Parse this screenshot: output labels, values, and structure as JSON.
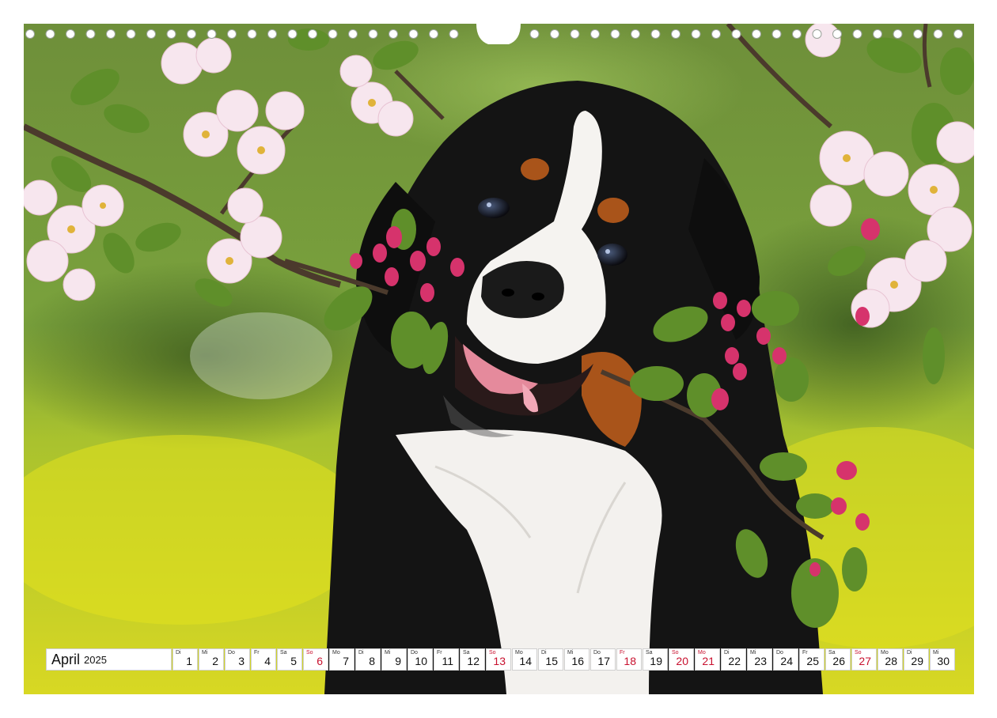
{
  "calendar": {
    "month": "April",
    "year": "2025",
    "days": [
      {
        "wd": "Di",
        "d": "1",
        "red": false
      },
      {
        "wd": "Mi",
        "d": "2",
        "red": false
      },
      {
        "wd": "Do",
        "d": "3",
        "red": false
      },
      {
        "wd": "Fr",
        "d": "4",
        "red": false
      },
      {
        "wd": "Sa",
        "d": "5",
        "red": false
      },
      {
        "wd": "So",
        "d": "6",
        "red": true
      },
      {
        "wd": "Mo",
        "d": "7",
        "red": false
      },
      {
        "wd": "Di",
        "d": "8",
        "red": false
      },
      {
        "wd": "Mi",
        "d": "9",
        "red": false
      },
      {
        "wd": "Do",
        "d": "10",
        "red": false
      },
      {
        "wd": "Fr",
        "d": "11",
        "red": false
      },
      {
        "wd": "Sa",
        "d": "12",
        "red": false
      },
      {
        "wd": "So",
        "d": "13",
        "red": true
      },
      {
        "wd": "Mo",
        "d": "14",
        "red": false
      },
      {
        "wd": "Di",
        "d": "15",
        "red": false
      },
      {
        "wd": "Mi",
        "d": "16",
        "red": false
      },
      {
        "wd": "Do",
        "d": "17",
        "red": false
      },
      {
        "wd": "Fr",
        "d": "18",
        "red": true
      },
      {
        "wd": "Sa",
        "d": "19",
        "red": false
      },
      {
        "wd": "So",
        "d": "20",
        "red": true
      },
      {
        "wd": "Mo",
        "d": "21",
        "red": true
      },
      {
        "wd": "Di",
        "d": "22",
        "red": false
      },
      {
        "wd": "Mi",
        "d": "23",
        "red": false
      },
      {
        "wd": "Do",
        "d": "24",
        "red": false
      },
      {
        "wd": "Fr",
        "d": "25",
        "red": false
      },
      {
        "wd": "Sa",
        "d": "26",
        "red": false
      },
      {
        "wd": "So",
        "d": "27",
        "red": true
      },
      {
        "wd": "Mo",
        "d": "28",
        "red": false
      },
      {
        "wd": "Di",
        "d": "29",
        "red": false
      },
      {
        "wd": "Mi",
        "d": "30",
        "red": false
      }
    ]
  },
  "photo": {
    "subject": "bernese-mountain-dog-puppy",
    "colors": {
      "grass": "#d6d923",
      "foliage": "#5f8f2a",
      "fur": "#141414",
      "tan": "#a9541a",
      "blossom": "#f7e6ee",
      "bud": "#d6336c"
    }
  }
}
